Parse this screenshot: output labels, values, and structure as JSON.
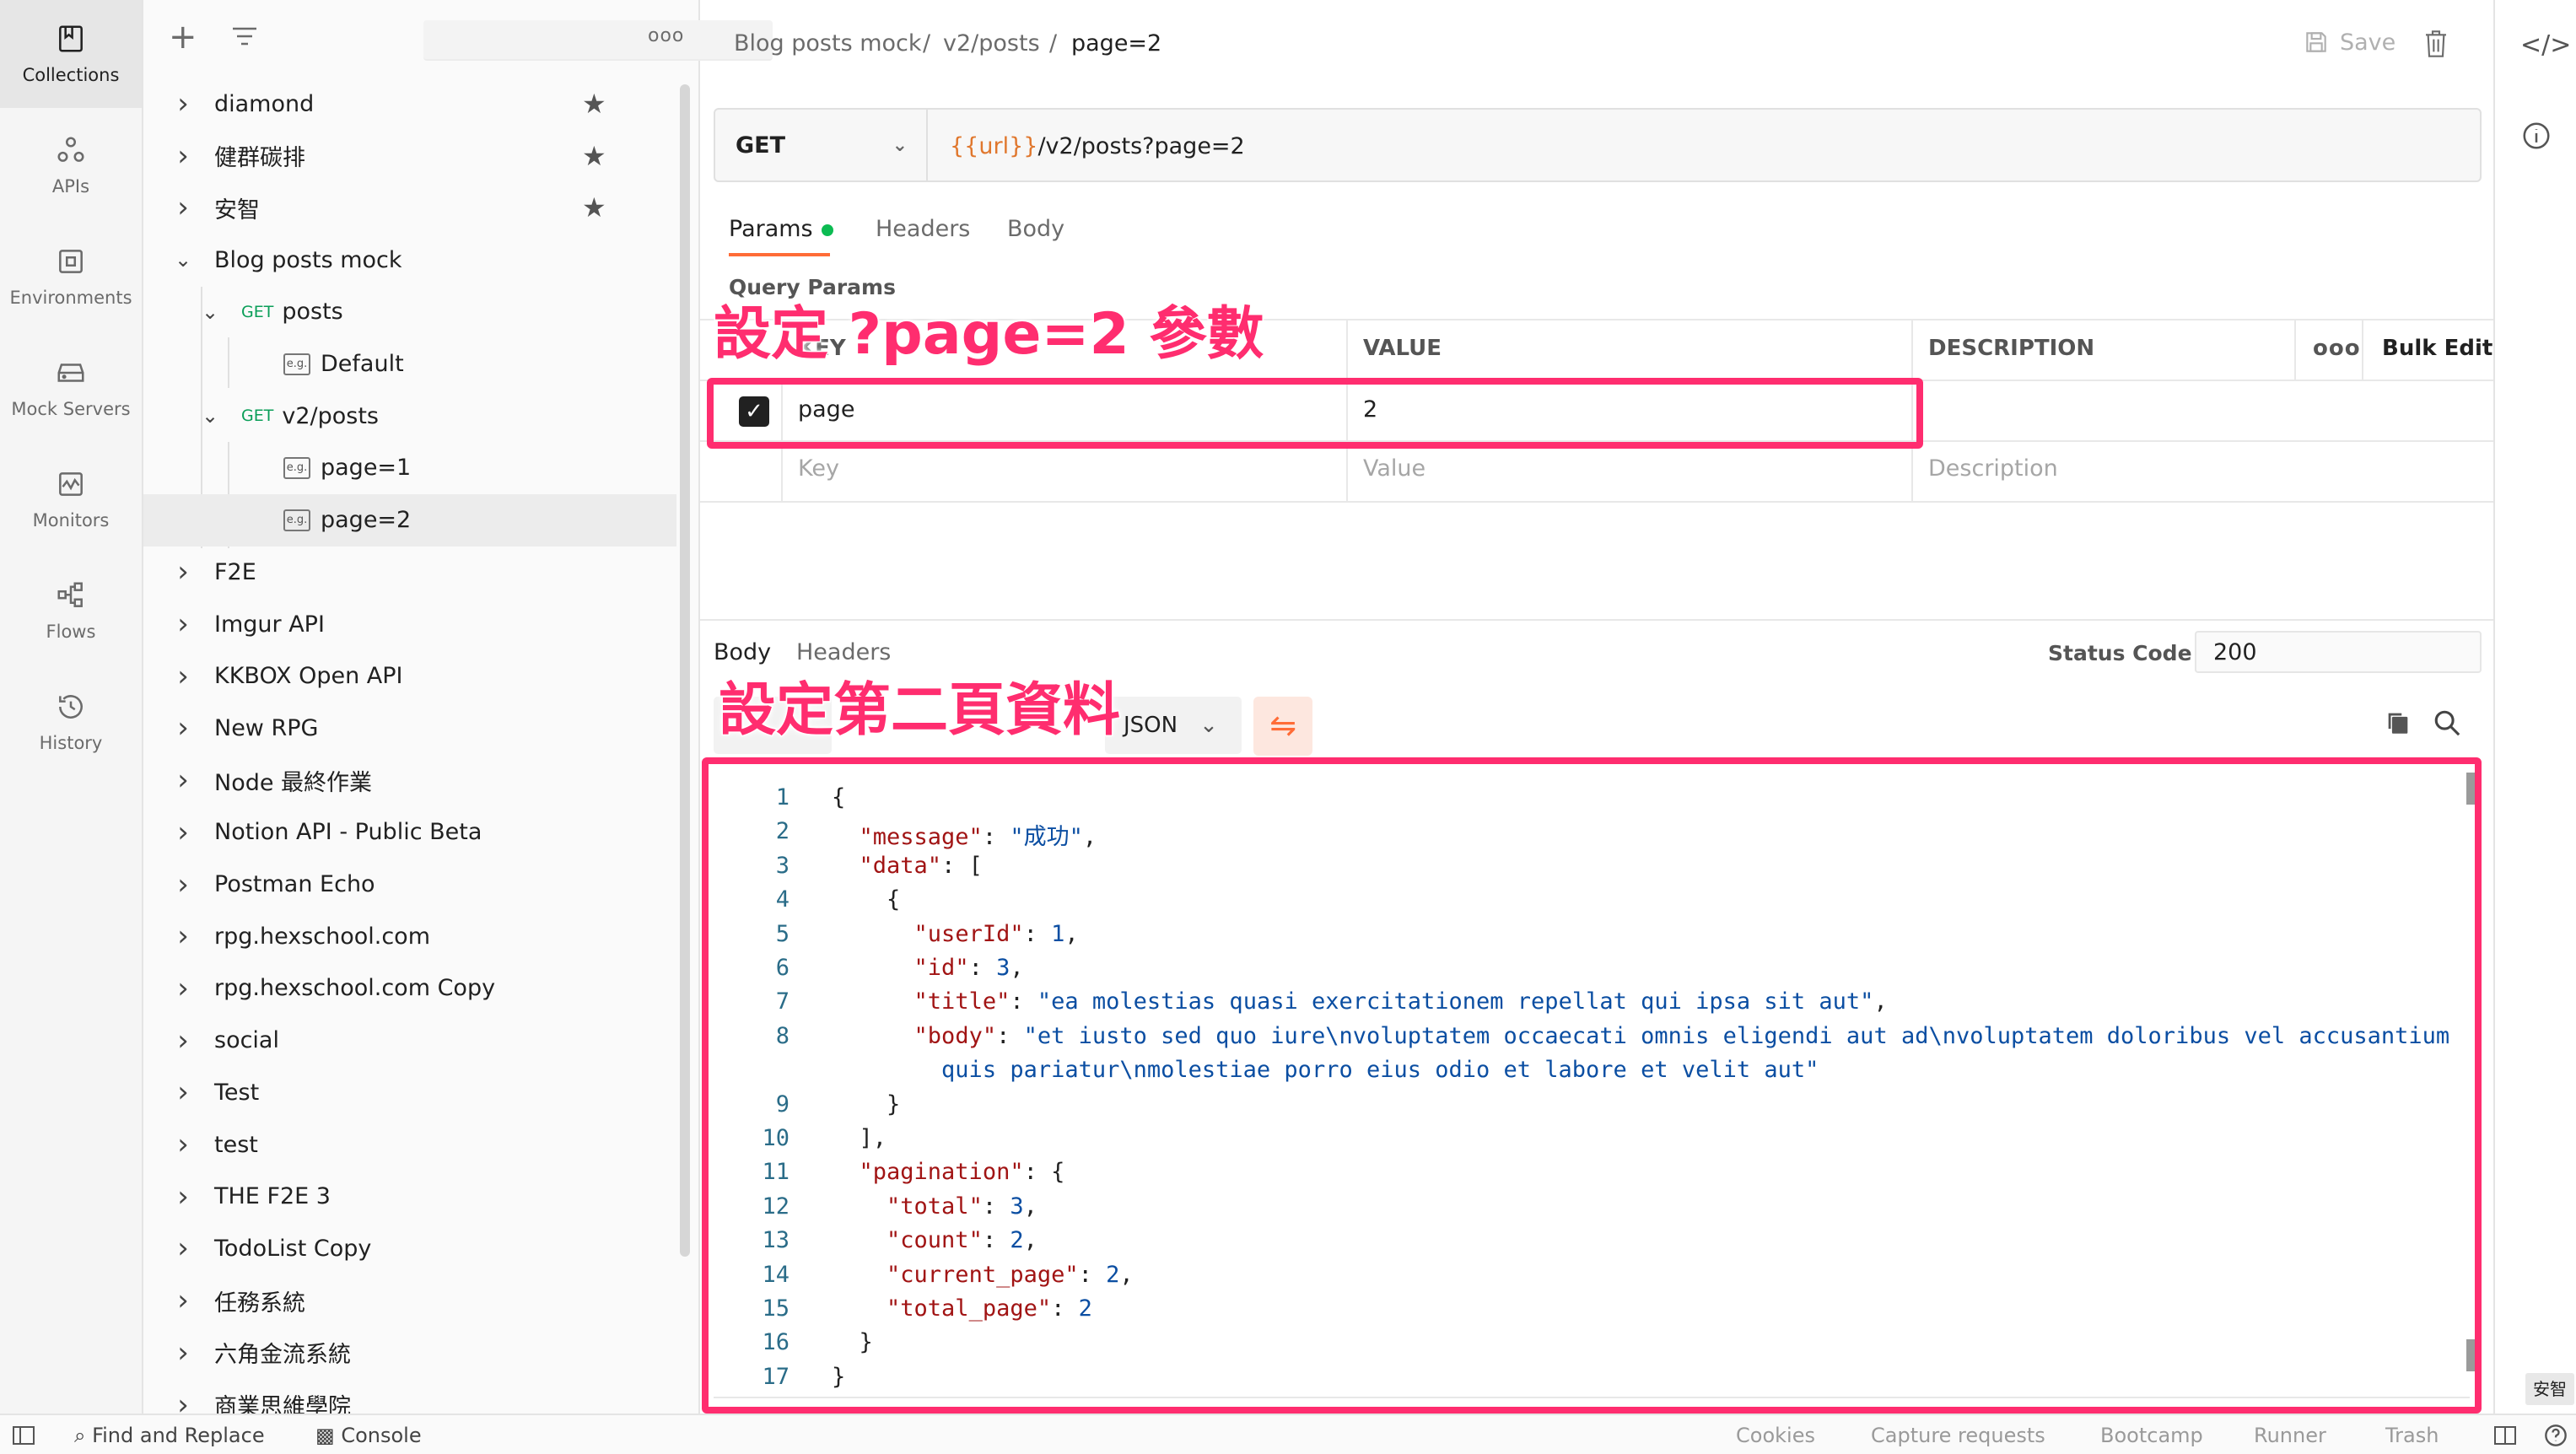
{
  "rail": {
    "items": [
      {
        "label": "Collections",
        "icon": "collections-icon"
      },
      {
        "label": "APIs",
        "icon": "apis-icon"
      },
      {
        "label": "Environments",
        "icon": "environments-icon"
      },
      {
        "label": "Mock Servers",
        "icon": "mock-servers-icon"
      },
      {
        "label": "Monitors",
        "icon": "monitors-icon"
      },
      {
        "label": "Flows",
        "icon": "flows-icon"
      },
      {
        "label": "History",
        "icon": "history-icon"
      }
    ]
  },
  "sidebar": {
    "toolbar": {
      "add_icon": "plus-icon",
      "filter_icon": "filter-icon",
      "more": "ooo"
    },
    "tree": [
      {
        "label": "diamond",
        "starred": true
      },
      {
        "label": "健群碳排",
        "starred": true
      },
      {
        "label": "安智",
        "starred": true
      },
      {
        "label": "Blog posts mock",
        "expanded": true
      },
      {
        "label": "posts",
        "method": "GET",
        "expanded": true
      },
      {
        "label": "Default",
        "type": "example"
      },
      {
        "label": "v2/posts",
        "method": "GET",
        "expanded": true
      },
      {
        "label": "page=1",
        "type": "example"
      },
      {
        "label": "page=2",
        "type": "example",
        "selected": true
      },
      {
        "label": "F2E"
      },
      {
        "label": "Imgur API"
      },
      {
        "label": "KKBOX Open API"
      },
      {
        "label": "New RPG"
      },
      {
        "label": "Node 最終作業"
      },
      {
        "label": "Notion API - Public Beta"
      },
      {
        "label": "Postman Echo"
      },
      {
        "label": "rpg.hexschool.com"
      },
      {
        "label": "rpg.hexschool.com Copy"
      },
      {
        "label": "social"
      },
      {
        "label": "Test"
      },
      {
        "label": "test"
      },
      {
        "label": "THE F2E 3"
      },
      {
        "label": "TodoList Copy"
      },
      {
        "label": "任務系統"
      },
      {
        "label": "六角金流系統"
      },
      {
        "label": "商業思維學院"
      }
    ],
    "example_icon_text": "e.g."
  },
  "breadcrumb": [
    "Blog posts mock",
    "v2/posts",
    "page=2"
  ],
  "breadcrumb_sep": "/",
  "header": {
    "save_label": "Save"
  },
  "request": {
    "method": "GET",
    "url_var": "{{url}}",
    "url_rest": "/v2/posts?page=2"
  },
  "request_tabs": [
    "Params",
    "Headers",
    "Body"
  ],
  "params": {
    "section_title": "Query Params",
    "columns": {
      "key": "KEY",
      "value": "VALUE",
      "description": "DESCRIPTION"
    },
    "more": "ooo",
    "bulk_edit": "Bulk Edit",
    "rows": [
      {
        "key": "page",
        "value": "2",
        "checked": true
      }
    ],
    "placeholder": {
      "key": "Key",
      "value": "Value",
      "description": "Description"
    }
  },
  "annotations": {
    "params_note": "設定 ?page=2 參數",
    "body_note": "設定第二頁資料"
  },
  "response": {
    "tabs": [
      "Body",
      "Headers"
    ],
    "status_label": "Status Code",
    "status_value": "200",
    "format_label": "JSON"
  },
  "code_lines": [
    {
      "n": "1",
      "html": "<span class='p'>{</span>"
    },
    {
      "n": "2",
      "html": "  <span class='k'>\"message\"</span><span class='p'>: </span><span class='s'>\"成功\"</span><span class='p'>,</span>"
    },
    {
      "n": "3",
      "html": "  <span class='k'>\"data\"</span><span class='p'>: [</span>"
    },
    {
      "n": "4",
      "html": "    <span class='p'>{</span>"
    },
    {
      "n": "5",
      "html": "      <span class='k'>\"userId\"</span><span class='p'>: </span><span class='n'>1</span><span class='p'>,</span>"
    },
    {
      "n": "6",
      "html": "      <span class='k'>\"id\"</span><span class='p'>: </span><span class='n'>3</span><span class='p'>,</span>"
    },
    {
      "n": "7",
      "html": "      <span class='k'>\"title\"</span><span class='p'>: </span><span class='s'>\"ea molestias quasi exercitationem repellat qui ipsa sit aut\"</span><span class='p'>,</span>"
    },
    {
      "n": "8",
      "html": "      <span class='k'>\"body\"</span><span class='p'>: </span><span class='s'>\"et iusto sed quo iure\\nvoluptatem occaecati omnis eligendi aut ad\\nvoluptatem doloribus vel accusantium</span>"
    },
    {
      "n": "",
      "html": "        <span class='s'>quis pariatur\\nmolestiae porro eius odio et labore et velit aut\"</span>"
    },
    {
      "n": "9",
      "html": "    <span class='p'>}</span>"
    },
    {
      "n": "10",
      "html": "  <span class='p'>],</span>"
    },
    {
      "n": "11",
      "html": "  <span class='k'>\"pagination\"</span><span class='p'>: {</span>"
    },
    {
      "n": "12",
      "html": "    <span class='k'>\"total\"</span><span class='p'>: </span><span class='n'>3</span><span class='p'>,</span>"
    },
    {
      "n": "13",
      "html": "    <span class='k'>\"count\"</span><span class='p'>: </span><span class='n'>2</span><span class='p'>,</span>"
    },
    {
      "n": "14",
      "html": "    <span class='k'>\"current_page\"</span><span class='p'>: </span><span class='n'>2</span><span class='p'>,</span>"
    },
    {
      "n": "15",
      "html": "    <span class='k'>\"total_page\"</span><span class='p'>: </span><span class='n'>2</span>"
    },
    {
      "n": "16",
      "html": "  <span class='p'>}</span>"
    },
    {
      "n": "17",
      "html": "<span class='p'>}</span>"
    }
  ],
  "footer": {
    "find_replace": "Find and Replace",
    "console": "Console",
    "cookies": "Cookies",
    "capture": "Capture requests",
    "bootcamp": "Bootcamp",
    "runner": "Runner",
    "trash": "Trash"
  },
  "tooltip": "安智",
  "colors": {
    "accent": "#ff6c37",
    "annotation": "#ff2d6f",
    "get": "#0a9e58"
  }
}
